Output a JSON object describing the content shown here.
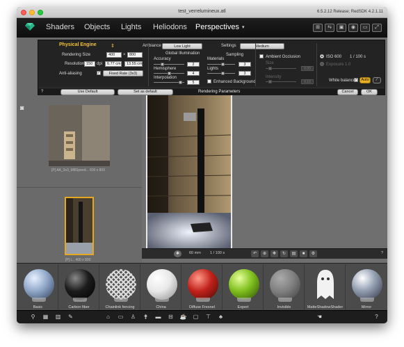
{
  "window": {
    "title": "test_verrelumineux.atl",
    "version": "6.5.2.12 Release; RedSDK 4.2.1.11"
  },
  "menu": {
    "items": [
      "Shaders",
      "Objects",
      "Lights",
      "Heliodons",
      "Perspectives"
    ],
    "active": "Perspectives",
    "toolbar_icons": [
      "cart-icon",
      "share-icon",
      "cube-icon",
      "camera-icon",
      "window-icon",
      "fullscreen-icon"
    ]
  },
  "render_panel": {
    "engine": "Physical Engine",
    "ambiance_label": "Ambiance",
    "ambiance_value": "Low Light",
    "settings_label": "Settings",
    "settings_value": "Medium",
    "rendering_size_label": "Rendering Size",
    "rendering_width": "400",
    "rendering_height": "800",
    "resolution_label": "Resolution",
    "resolution_value": "150",
    "resolution_unit": "dpi",
    "size_cm_w": "6.77 cm",
    "size_cm_h": "13.55 cm",
    "antialiasing_label": "Anti-aliasing",
    "antialiasing_value": "Fixed Rate (3x3)",
    "gi_header": "Global Illumination",
    "accuracy_label": "Accuracy",
    "accuracy_value": "2",
    "hemisphere_label": "Hemisphere",
    "hemisphere_value": "4",
    "interpolation_label": "Interpolation",
    "interpolation_value": "5",
    "sampling_header": "Sampling",
    "materials_label": "Materials",
    "materials_value": "3",
    "lights_label": "Lights",
    "lights_value": "3",
    "enhanced_bg_label": "Enhanced Background",
    "ao_label": "Ambient Occlusion",
    "ao_size_label": "Size",
    "ao_size_value": "0.00",
    "ao_intensity_label": "Intensity",
    "ao_intensity_value": "0.10",
    "iso_label": "ISO 600",
    "shutter_value": "1 / 100 s",
    "exposure_label": "Exposure 1.0",
    "white_balance_label": "White balance",
    "auto_label": "Auto",
    "help": "?",
    "use_default": "Use Default",
    "set_as_default": "Set as default",
    "footer_title": "Rendering Parameters",
    "cancel": "Cancel",
    "ok": "OK"
  },
  "thumbnails": [
    {
      "caption": "[P] AA_3x3_MBSpeed... 600 x 800"
    },
    {
      "caption": "[P] t... 400 x 800"
    }
  ],
  "main_toolbar": {
    "focal": "60 mm",
    "shutter": "1 / 100 s",
    "help": "?"
  },
  "shaders": [
    {
      "label": "Basic",
      "color": "#8fa7c8"
    },
    {
      "label": "Carbon fiber",
      "color": "#1c1c1c"
    },
    {
      "label": "Chainlink fencing",
      "color": "#b8b8b8"
    },
    {
      "label": "China",
      "color": "#e8e8e8"
    },
    {
      "label": "Diffuse Fresnel",
      "color": "#c0221a"
    },
    {
      "label": "Expert",
      "color": "#7fbf1e"
    },
    {
      "label": "Invisible",
      "color": "#8a8a8a"
    },
    {
      "label": "MatteShadowShader",
      "color": "#f2f2f2"
    },
    {
      "label": "Mirror",
      "color": "#9aa6b8"
    }
  ],
  "bottom_icons": [
    "shader-tool-icon",
    "grid-icon",
    "brick-icon",
    "brush-icon",
    "building-icon",
    "tv-icon",
    "chair-icon",
    "lamp-icon",
    "sofa-icon",
    "car-icon",
    "cup-icon",
    "box-icon",
    "table-icon",
    "tree-icon",
    "hand-icon",
    "help-icon"
  ]
}
